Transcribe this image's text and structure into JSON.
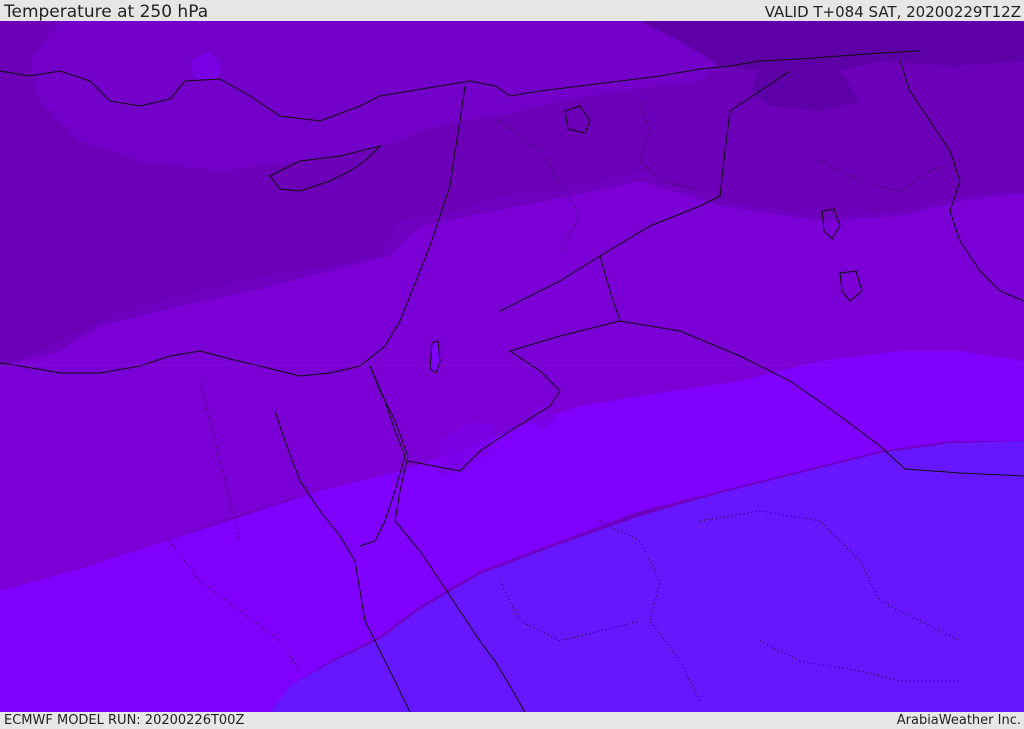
{
  "header": {
    "title": "Temperature at 250 hPa",
    "valid_time": "VALID T+084 SAT, 20200229T12Z"
  },
  "footer": {
    "model_run": "ECMWF MODEL RUN: 20200226T00Z",
    "credit": "ArabiaWeather Inc."
  },
  "map": {
    "region": "Eastern Mediterranean, Levant, Egypt, Arabian Peninsula",
    "colors": {
      "band_darkest": "#5d00a8",
      "band_dark": "#6c00b9",
      "band_mid_dark": "#7300c8",
      "band_mid": "#7a00d6",
      "band_bright": "#7f00ff",
      "band_blue": "#6617ff",
      "coastline": "#111111",
      "borders": "#111111"
    }
  }
}
